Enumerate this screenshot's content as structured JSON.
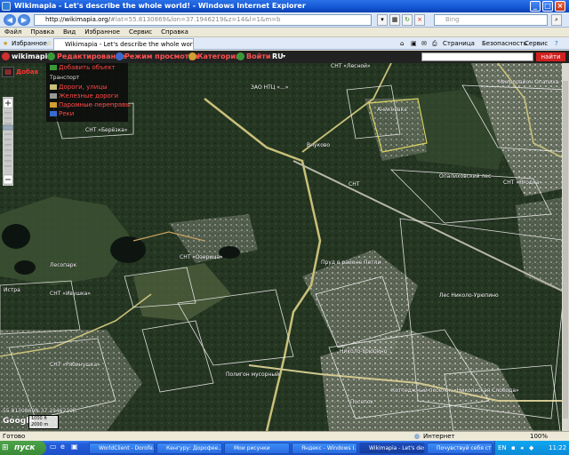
{
  "window": {
    "title": "Wikimapia - Let's describe the whole world! - Windows Internet Explorer",
    "colors": {
      "titlebar": "#1457d4",
      "close": "#d9401b"
    }
  },
  "address_bar": {
    "url_host": "http://wikimapia.org/",
    "url_rest": "#lat=55.8130869&lon=37.1946219&z=14&l=1&m=b",
    "search_placeholder": "Bing"
  },
  "menubar": {
    "items": [
      "Файл",
      "Правка",
      "Вид",
      "Избранное",
      "Сервис",
      "Справка"
    ]
  },
  "tabbar": {
    "favorites": "Избранное",
    "tab_title": "Wikimapia - Let's describe the whole world!",
    "toolbar": [
      "Страница",
      "Безопасность",
      "Сервис"
    ]
  },
  "wikimapia": {
    "logo": "wikimapia",
    "menu": [
      {
        "label": "Редактирование",
        "icon": "pencil-icon"
      },
      {
        "label": "Режим просмотра",
        "icon": "eye-icon"
      },
      {
        "label": "Категории",
        "icon": "folder-icon"
      },
      {
        "label": "Войти",
        "icon": "user-icon"
      },
      {
        "label": "RU",
        "icon": "chevron-down-icon"
      }
    ],
    "search_button": "найти",
    "side_label": "Добав"
  },
  "dropdown": {
    "top_item": "Добавить объект",
    "section": "Транспорт",
    "items": [
      "Дороги, улицы",
      "Железные дороги",
      "Паромные переправы",
      "Реки"
    ],
    "colors": {
      "text": "#ff4646",
      "bg": "#0a0a0a"
    }
  },
  "map": {
    "labels": [
      "СНТ «Лесной»",
      "ЗАО НТЦ «...»",
      "Микрорайон Опалиха",
      "Аникеевка",
      "СНТ «Берёзка»",
      "Внуково",
      "СНТ",
      "Опалиховский лес",
      "СНТ «Ягодка»",
      "СНТ «Озерица»",
      "Лесопарк",
      "Пруд в районе Петли",
      "Лес Николо-Урюпино",
      "СНТ «Ивушка»",
      "СНТ «Рябинушка»",
      "Николо-Урюпино",
      "Коттеджный посёлок «Никольская Слобода»",
      "Полигон мусорный",
      "Поселок",
      "Истра"
    ],
    "coords": "55.8130869N 37.1946219E",
    "scale_top": "1000 ft",
    "scale_bottom": "2000 m",
    "google": "Google"
  },
  "status": {
    "left": "Готово",
    "zone": "Интернет",
    "zoom": "100%"
  },
  "taskbar": {
    "start": "пуск",
    "buttons": [
      "WorldClient - Dorofe...",
      "Кенгуру: Дорофее...",
      "Мои рисунки",
      "Яндекс - Windows I...",
      "Wikimapia - Let's desc...",
      "Почувствуй себя ст..."
    ],
    "active_index": 4,
    "lang": "EN",
    "time": "11:22"
  }
}
